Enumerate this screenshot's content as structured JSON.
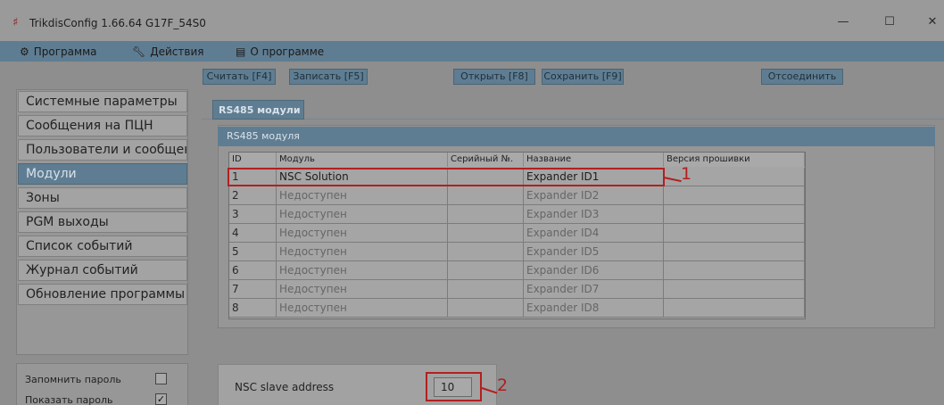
{
  "window": {
    "title": "TrikdisConfig 1.66.64   G17F_54S0",
    "minimize_glyph": "—",
    "maximize_glyph": "☐",
    "close_glyph": "✕"
  },
  "menu": [
    {
      "label": "Программа",
      "icon": "gear-icon"
    },
    {
      "label": "Действия",
      "icon": "wrench-icon"
    },
    {
      "label": "О программе",
      "icon": "info-window-icon"
    }
  ],
  "toolbar": {
    "read": "Считать [F4]",
    "write": "Записать [F5]",
    "open": "Открыть [F8]",
    "save": "Сохранить [F9]",
    "disconnect": "Отсоединить"
  },
  "nav": {
    "items": [
      "Системные параметры",
      "Сообщения на ПЦН",
      "Пользователи и сообщен",
      "Модули",
      "Зоны",
      "PGM выходы",
      "Список событий",
      "Журнал событий",
      "Обновление программы"
    ],
    "active_index": 3,
    "remember_password": "Запомнить пароль",
    "remember_checked": false,
    "show_password": "Показать пароль",
    "show_checked": true
  },
  "tab": {
    "label": "RS485 модули"
  },
  "panel": {
    "title": "RS485 модуля"
  },
  "grid": {
    "columns": [
      "ID",
      "Модуль",
      "Серийный №.",
      "Название",
      "Версия прошивки"
    ],
    "rows": [
      [
        "1",
        "NSC Solution",
        "",
        "Expander ID1",
        ""
      ],
      [
        "2",
        "Недоступен",
        "",
        "Expander ID2",
        ""
      ],
      [
        "3",
        "Недоступен",
        "",
        "Expander ID3",
        ""
      ],
      [
        "4",
        "Недоступен",
        "",
        "Expander ID4",
        ""
      ],
      [
        "5",
        "Недоступен",
        "",
        "Expander ID5",
        ""
      ],
      [
        "6",
        "Недоступен",
        "",
        "Expander ID6",
        ""
      ],
      [
        "7",
        "Недоступен",
        "",
        "Expander ID7",
        ""
      ],
      [
        "8",
        "Недоступен",
        "",
        "Expander ID8",
        ""
      ]
    ]
  },
  "annotations": {
    "one": "1",
    "two": "2",
    "color": "#b31f1f"
  },
  "slave": {
    "label": "NSC slave address",
    "value": "10"
  }
}
